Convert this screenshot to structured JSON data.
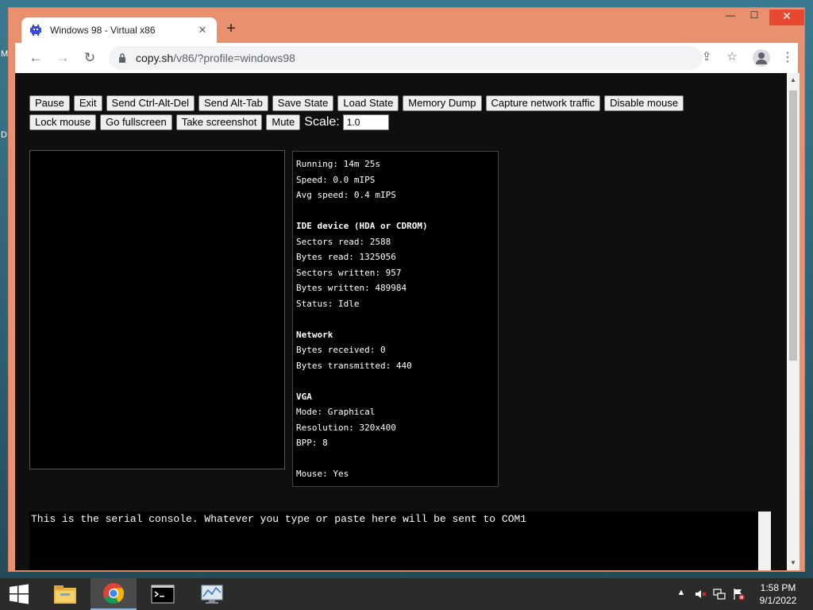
{
  "desktop": {
    "glyphs": [
      "M",
      "D"
    ]
  },
  "browser": {
    "tab": {
      "title": "Windows 98 - Virtual x86",
      "close": "✕"
    },
    "new_tab": "+",
    "window_controls": {
      "minimize": "—",
      "maximize": "☐",
      "close": "✕"
    },
    "nav": {
      "back": "←",
      "forward": "→",
      "reload": "↻"
    },
    "url": {
      "host": "copy.sh",
      "path": "/v86/?profile=windows98"
    },
    "icons": {
      "share": "⇪",
      "bookmark": "☆",
      "menu": "⋮"
    }
  },
  "emulator": {
    "buttons_row1": [
      "Pause",
      "Exit",
      "Send Ctrl-Alt-Del",
      "Send Alt-Tab",
      "Save State",
      "Load State",
      "Memory Dump",
      "Capture network traffic",
      "Disable mouse"
    ],
    "buttons_row2": [
      "Lock mouse",
      "Go fullscreen",
      "Take screenshot",
      "Mute"
    ],
    "scale_label": "Scale:",
    "scale_value": "1.0",
    "info_lines": [
      {
        "text": "Running: 14m 25s",
        "head": false
      },
      {
        "text": "Speed: 0.0 mIPS",
        "head": false
      },
      {
        "text": "Avg speed: 0.4 mIPS",
        "head": false
      },
      {
        "text": "",
        "head": false
      },
      {
        "text": "IDE device (HDA or CDROM)",
        "head": true
      },
      {
        "text": "Sectors read: 2588",
        "head": false
      },
      {
        "text": "Bytes read: 1325056",
        "head": false
      },
      {
        "text": "Sectors written: 957",
        "head": false
      },
      {
        "text": "Bytes written: 489984",
        "head": false
      },
      {
        "text": "Status: Idle",
        "head": false
      },
      {
        "text": "",
        "head": false
      },
      {
        "text": "Network",
        "head": true
      },
      {
        "text": "Bytes received: 0",
        "head": false
      },
      {
        "text": "Bytes transmitted: 440",
        "head": false
      },
      {
        "text": "",
        "head": false
      },
      {
        "text": "VGA",
        "head": true
      },
      {
        "text": "Mode: Graphical",
        "head": false
      },
      {
        "text": "Resolution: 320x400",
        "head": false
      },
      {
        "text": "BPP: 8",
        "head": false
      },
      {
        "text": "",
        "head": false
      },
      {
        "text": "Mouse: Yes",
        "head": false
      }
    ],
    "serial_console": "This is the serial console. Whatever you type or paste here will be sent to COM1"
  },
  "taskbar": {
    "apps": [
      "file-explorer",
      "chrome",
      "command-prompt",
      "performance-monitor"
    ],
    "clock": {
      "time": "1:58 PM",
      "date": "9/1/2022"
    }
  },
  "colors": {
    "browser_frame": "#e9916e",
    "page_background": "#0f0f0f",
    "taskbar": "#2b2b2b"
  }
}
